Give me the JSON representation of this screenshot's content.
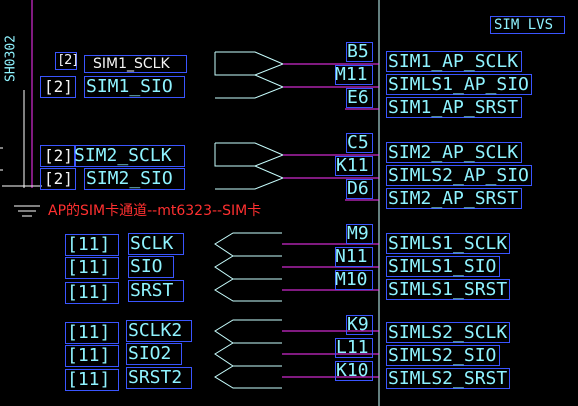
{
  "header": {
    "sim_lvs": "SIM LVS"
  },
  "sheet_ref": "SH0302",
  "annotation": "AP的SIM卡通道--mt6323--SIM卡",
  "colors": {
    "wire": "#ff33ff",
    "component": "#c8ffff",
    "box": "#3a55ff",
    "annotation": "#ff3030"
  },
  "left_ports": {
    "sim1_sclk": {
      "ref": "[2]",
      "name": "SIM1_SCLK"
    },
    "sim1_sio": {
      "ref": "[2]",
      "name": "SIM1_SIO"
    },
    "sim2_sclk": {
      "ref": "[2]",
      "name": "SIM2_SCLK"
    },
    "sim2_sio": {
      "ref": "[2]",
      "name": "SIM2_SIO"
    },
    "sclk": {
      "ref": "[11]",
      "name": "SCLK"
    },
    "sio": {
      "ref": "[11]",
      "name": "SIO"
    },
    "srst": {
      "ref": "[11]",
      "name": "SRST"
    },
    "sclk2": {
      "ref": "[11]",
      "name": "SCLK2"
    },
    "sio2": {
      "ref": "[11]",
      "name": "SIO2"
    },
    "srst2": {
      "ref": "[11]",
      "name": "SRST2"
    }
  },
  "pins": {
    "b5": {
      "pin": "B5",
      "net": "SIM1_AP_SCLK"
    },
    "m11": {
      "pin": "M11",
      "net": "SIMLS1_AP_SIO"
    },
    "e6": {
      "pin": "E6",
      "net": "SIM1_AP_SRST"
    },
    "c5": {
      "pin": "C5",
      "net": "SIM2_AP_SCLK"
    },
    "k11": {
      "pin": "K11",
      "net": "SIMLS2_AP_SIO"
    },
    "d6": {
      "pin": "D6",
      "net": "SIM2_AP_SRST"
    },
    "m9": {
      "pin": "M9",
      "net": "SIMLS1_SCLK"
    },
    "n11": {
      "pin": "N11",
      "net": "SIMLS1_SIO"
    },
    "m10": {
      "pin": "M10",
      "net": "SIMLS1_SRST"
    },
    "k9": {
      "pin": "K9",
      "net": "SIMLS2_SCLK"
    },
    "l11": {
      "pin": "L11",
      "net": "SIMLS2_SIO"
    },
    "k10": {
      "pin": "K10",
      "net": "SIMLS2_SRST"
    }
  }
}
